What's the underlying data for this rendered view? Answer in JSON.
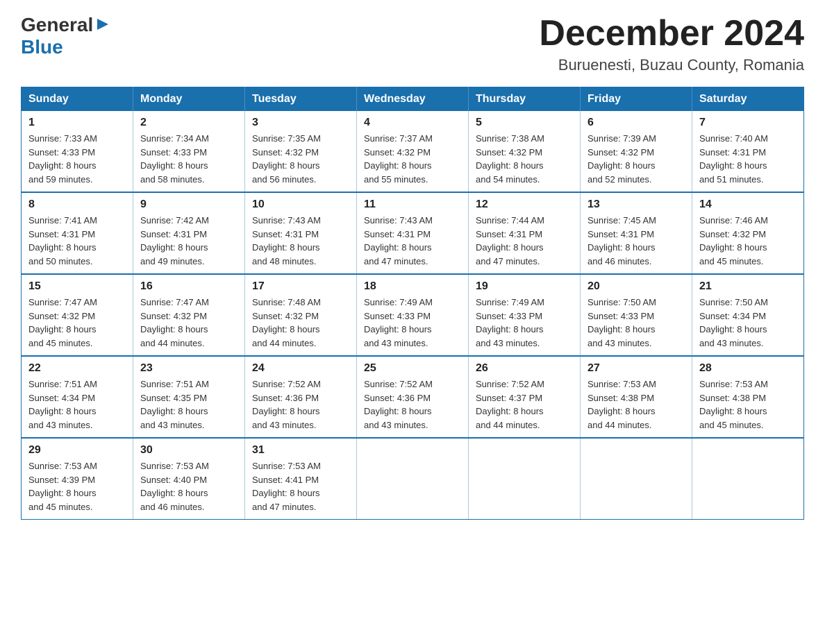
{
  "header": {
    "logo_general": "General",
    "logo_blue": "Blue",
    "main_title": "December 2024",
    "subtitle": "Buruenesti, Buzau County, Romania"
  },
  "days_of_week": [
    "Sunday",
    "Monday",
    "Tuesday",
    "Wednesday",
    "Thursday",
    "Friday",
    "Saturday"
  ],
  "weeks": [
    [
      {
        "day": "1",
        "sunrise": "7:33 AM",
        "sunset": "4:33 PM",
        "daylight": "8 hours and 59 minutes."
      },
      {
        "day": "2",
        "sunrise": "7:34 AM",
        "sunset": "4:33 PM",
        "daylight": "8 hours and 58 minutes."
      },
      {
        "day": "3",
        "sunrise": "7:35 AM",
        "sunset": "4:32 PM",
        "daylight": "8 hours and 56 minutes."
      },
      {
        "day": "4",
        "sunrise": "7:37 AM",
        "sunset": "4:32 PM",
        "daylight": "8 hours and 55 minutes."
      },
      {
        "day": "5",
        "sunrise": "7:38 AM",
        "sunset": "4:32 PM",
        "daylight": "8 hours and 54 minutes."
      },
      {
        "day": "6",
        "sunrise": "7:39 AM",
        "sunset": "4:32 PM",
        "daylight": "8 hours and 52 minutes."
      },
      {
        "day": "7",
        "sunrise": "7:40 AM",
        "sunset": "4:31 PM",
        "daylight": "8 hours and 51 minutes."
      }
    ],
    [
      {
        "day": "8",
        "sunrise": "7:41 AM",
        "sunset": "4:31 PM",
        "daylight": "8 hours and 50 minutes."
      },
      {
        "day": "9",
        "sunrise": "7:42 AM",
        "sunset": "4:31 PM",
        "daylight": "8 hours and 49 minutes."
      },
      {
        "day": "10",
        "sunrise": "7:43 AM",
        "sunset": "4:31 PM",
        "daylight": "8 hours and 48 minutes."
      },
      {
        "day": "11",
        "sunrise": "7:43 AM",
        "sunset": "4:31 PM",
        "daylight": "8 hours and 47 minutes."
      },
      {
        "day": "12",
        "sunrise": "7:44 AM",
        "sunset": "4:31 PM",
        "daylight": "8 hours and 47 minutes."
      },
      {
        "day": "13",
        "sunrise": "7:45 AM",
        "sunset": "4:31 PM",
        "daylight": "8 hours and 46 minutes."
      },
      {
        "day": "14",
        "sunrise": "7:46 AM",
        "sunset": "4:32 PM",
        "daylight": "8 hours and 45 minutes."
      }
    ],
    [
      {
        "day": "15",
        "sunrise": "7:47 AM",
        "sunset": "4:32 PM",
        "daylight": "8 hours and 45 minutes."
      },
      {
        "day": "16",
        "sunrise": "7:47 AM",
        "sunset": "4:32 PM",
        "daylight": "8 hours and 44 minutes."
      },
      {
        "day": "17",
        "sunrise": "7:48 AM",
        "sunset": "4:32 PM",
        "daylight": "8 hours and 44 minutes."
      },
      {
        "day": "18",
        "sunrise": "7:49 AM",
        "sunset": "4:33 PM",
        "daylight": "8 hours and 43 minutes."
      },
      {
        "day": "19",
        "sunrise": "7:49 AM",
        "sunset": "4:33 PM",
        "daylight": "8 hours and 43 minutes."
      },
      {
        "day": "20",
        "sunrise": "7:50 AM",
        "sunset": "4:33 PM",
        "daylight": "8 hours and 43 minutes."
      },
      {
        "day": "21",
        "sunrise": "7:50 AM",
        "sunset": "4:34 PM",
        "daylight": "8 hours and 43 minutes."
      }
    ],
    [
      {
        "day": "22",
        "sunrise": "7:51 AM",
        "sunset": "4:34 PM",
        "daylight": "8 hours and 43 minutes."
      },
      {
        "day": "23",
        "sunrise": "7:51 AM",
        "sunset": "4:35 PM",
        "daylight": "8 hours and 43 minutes."
      },
      {
        "day": "24",
        "sunrise": "7:52 AM",
        "sunset": "4:36 PM",
        "daylight": "8 hours and 43 minutes."
      },
      {
        "day": "25",
        "sunrise": "7:52 AM",
        "sunset": "4:36 PM",
        "daylight": "8 hours and 43 minutes."
      },
      {
        "day": "26",
        "sunrise": "7:52 AM",
        "sunset": "4:37 PM",
        "daylight": "8 hours and 44 minutes."
      },
      {
        "day": "27",
        "sunrise": "7:53 AM",
        "sunset": "4:38 PM",
        "daylight": "8 hours and 44 minutes."
      },
      {
        "day": "28",
        "sunrise": "7:53 AM",
        "sunset": "4:38 PM",
        "daylight": "8 hours and 45 minutes."
      }
    ],
    [
      {
        "day": "29",
        "sunrise": "7:53 AM",
        "sunset": "4:39 PM",
        "daylight": "8 hours and 45 minutes."
      },
      {
        "day": "30",
        "sunrise": "7:53 AM",
        "sunset": "4:40 PM",
        "daylight": "8 hours and 46 minutes."
      },
      {
        "day": "31",
        "sunrise": "7:53 AM",
        "sunset": "4:41 PM",
        "daylight": "8 hours and 47 minutes."
      },
      null,
      null,
      null,
      null
    ]
  ],
  "labels": {
    "sunrise": "Sunrise:",
    "sunset": "Sunset:",
    "daylight": "Daylight:"
  }
}
